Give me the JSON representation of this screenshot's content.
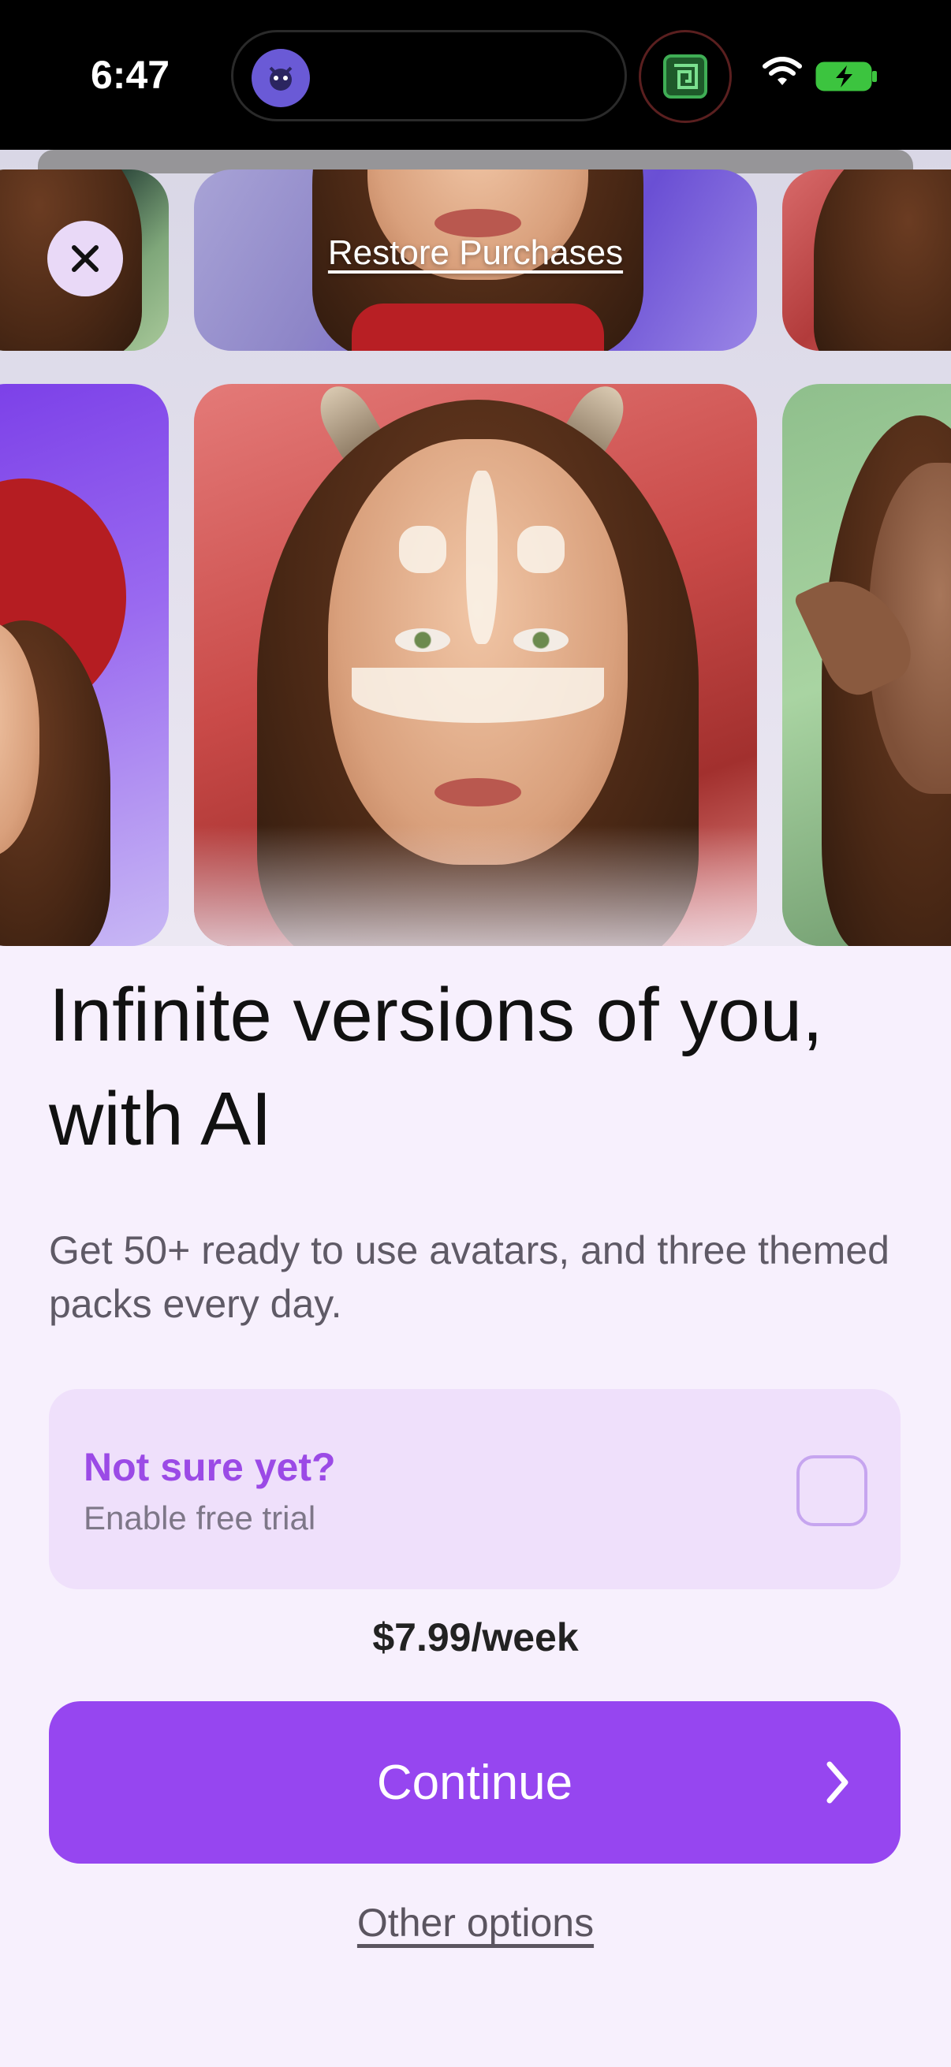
{
  "status_bar": {
    "time": "6:47",
    "icons": [
      "app-activity-icon",
      "recording-app-icon",
      "wifi-icon",
      "battery-charging-icon"
    ]
  },
  "header": {
    "close_icon": "close-icon",
    "restore_label": "Restore Purchases"
  },
  "hero": {
    "description_icons": [
      "avatar-tile-icon"
    ]
  },
  "content": {
    "headline": "Infinite versions of you, with AI",
    "subtext": "Get 50+ ready to use avatars, and three themed packs every day."
  },
  "trial": {
    "title": "Not sure yet?",
    "subtitle": "Enable free trial",
    "enabled": false
  },
  "pricing": {
    "price": "$7.99/week"
  },
  "actions": {
    "continue_label": "Continue",
    "other_options_label": "Other options"
  },
  "colors": {
    "accent": "#9646f0",
    "accent_text": "#9b4ae6",
    "card_bg": "#efe0fb",
    "page_bg": "#f7f0fd"
  }
}
